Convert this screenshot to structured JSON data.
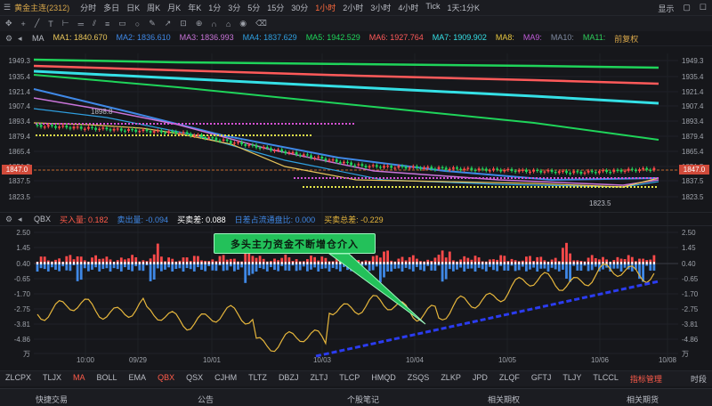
{
  "top": {
    "title": "黄金主连(2312)",
    "timeframes": [
      "分时",
      "多日",
      "日K",
      "周K",
      "月K",
      "年K",
      "1分",
      "3分",
      "5分",
      "15分",
      "30分",
      "1小时",
      "2小时",
      "3小时",
      "4小时",
      "Tick",
      "1天:1分K"
    ],
    "active_timeframe": "1小时",
    "right": [
      "显示",
      "▢",
      "☐"
    ]
  },
  "ma_row": {
    "label": "MA",
    "items": [
      {
        "text": "MA1:  1840.670",
        "color": "#e8c55a"
      },
      {
        "text": "MA2:  1836.610",
        "color": "#3f88e6"
      },
      {
        "text": "MA3:  1836.993",
        "color": "#c874d8"
      },
      {
        "text": "MA4:  1837.629",
        "color": "#2f9fe0"
      },
      {
        "text": "MA5:  1942.529",
        "color": "#1fd45a"
      },
      {
        "text": "MA6:  1927.764",
        "color": "#ff5a5a"
      },
      {
        "text": "MA7:  1909.902",
        "color": "#35e0e6"
      },
      {
        "text": "MA8:",
        "color": "#e6c640"
      },
      {
        "text": "MA9:",
        "color": "#c05bd8"
      },
      {
        "text": "MA10:",
        "color": "#7f8aa0"
      },
      {
        "text": "MA11:",
        "color": "#2ecc5a"
      },
      {
        "text": "前复权",
        "color": "#d7a64a"
      }
    ]
  },
  "price_axis": {
    "left": [
      "1949.3",
      "1935.4",
      "1921.4",
      "1907.4",
      "1893.4",
      "1879.4",
      "1865.4",
      "1851.5",
      "1847.0",
      "1837.5",
      "1823.5"
    ],
    "right": [
      "1949.3",
      "1935.4",
      "1921.4",
      "1907.4",
      "1893.4",
      "1879.4",
      "1865.4",
      "1851.5",
      "1847.0",
      "1837.5",
      "1823.5"
    ],
    "current_price": "1847.0",
    "annotation_high": "1898.8",
    "annotation_low": "1823.5"
  },
  "indicator_row": {
    "label": "QBX",
    "items": [
      {
        "text": "买入量:  0.182",
        "color": "#ff5b4a"
      },
      {
        "text": "卖出量:  -0.094",
        "color": "#3f88e6"
      },
      {
        "text": "买卖差:  0.088",
        "color": "#ffffff"
      },
      {
        "text": "日差占流通盘比:  0.000",
        "color": "#3f88e6"
      },
      {
        "text": "买卖总差:  -0.229",
        "color": "#e6b63c"
      }
    ]
  },
  "indicator_axis": {
    "left": [
      "2.50",
      "1.45",
      "0.40",
      "-0.65",
      "-1.70",
      "-2.75",
      "-3.81",
      "-4.86",
      "万"
    ],
    "right": [
      "2.50",
      "1.45",
      "0.40",
      "-0.65",
      "-1.70",
      "-2.75",
      "-3.81",
      "-4.86",
      "万"
    ]
  },
  "callout": "多头主力资金不断增仓介入",
  "time_axis": [
    "10:00",
    "09/29",
    "10/01",
    "10/03",
    "10/04",
    "10/05",
    "10/06",
    "10/08"
  ],
  "tabs": [
    "ZLCPX",
    "TLJX",
    "MA",
    "BOLL",
    "EMA",
    "QBX",
    "QSX",
    "CJHM",
    "TLTZ",
    "DBZJ",
    "ZLTJ",
    "TLCP",
    "HMQD",
    "ZSQS",
    "ZLKP",
    "JPD",
    "ZLQF",
    "GFTJ",
    "TLJY",
    "TLCCL",
    "指标管理"
  ],
  "tabs_red": [
    "MA",
    "QBX",
    "指标管理"
  ],
  "tabs_end": "时段",
  "footer": [
    "快捷交易",
    "公告",
    "个股笔记",
    "相关期权",
    "相关期货"
  ]
}
